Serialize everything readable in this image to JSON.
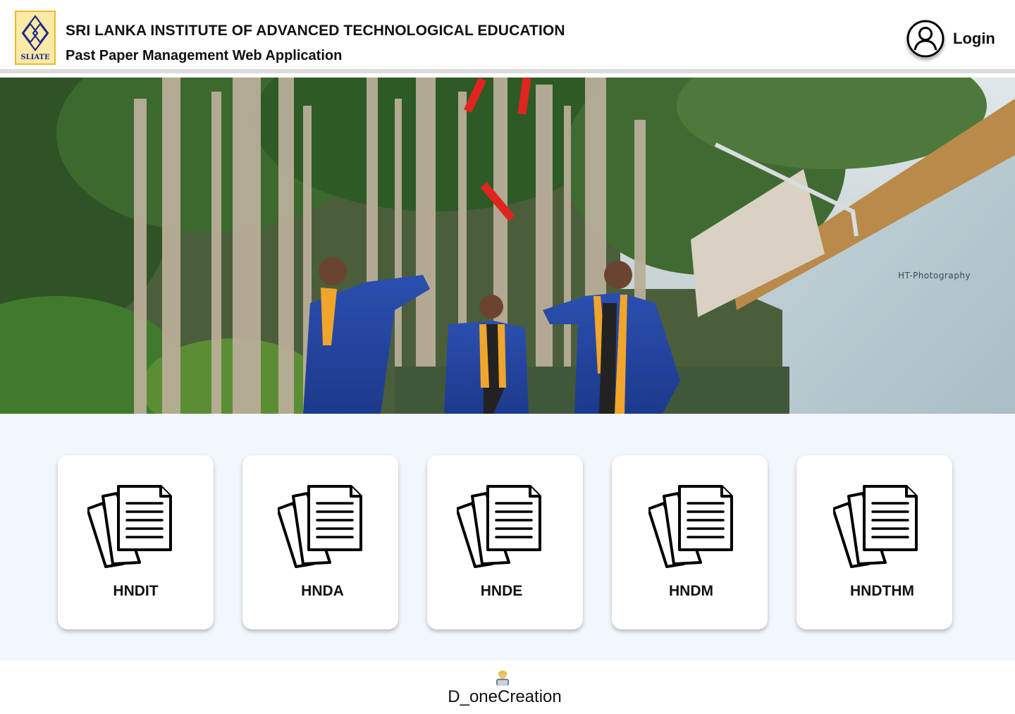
{
  "header": {
    "logo_text": "SLIATE",
    "institution_title": "SRI LANKA INSTITUTE OF ADVANCED TECHNOLOGICAL EDUCATION",
    "app_subtitle": "Past Paper Management Web Application",
    "login_label": "Login",
    "login_icon": "user-circle-icon"
  },
  "hero": {
    "photo_credit": "HT-Photography"
  },
  "programs": [
    {
      "label": "HNDIT",
      "icon": "documents-icon"
    },
    {
      "label": "HNDA",
      "icon": "documents-icon"
    },
    {
      "label": "HNDE",
      "icon": "documents-icon"
    },
    {
      "label": "HNDM",
      "icon": "documents-icon"
    },
    {
      "label": "HNDTHM",
      "icon": "documents-icon"
    }
  ],
  "footer": {
    "emoji_icon": "technologist-icon",
    "credit": "D_oneCreation"
  },
  "colors": {
    "programs_background": "#f2f6fd",
    "card_background": "#ffffff",
    "logo_background": "#fbe9a6",
    "logo_border": "#f0b92c",
    "logo_mark": "#1d2a8a"
  }
}
